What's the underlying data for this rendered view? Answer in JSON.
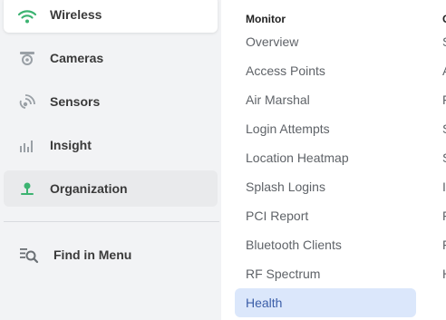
{
  "sidebar": {
    "items": [
      {
        "label": "Wireless",
        "icon": "wifi-icon"
      },
      {
        "label": "Cameras",
        "icon": "camera-icon"
      },
      {
        "label": "Sensors",
        "icon": "sensor-icon"
      },
      {
        "label": "Insight",
        "icon": "insight-chart-icon"
      },
      {
        "label": "Organization",
        "icon": "organization-icon"
      }
    ],
    "find_label": "Find in Menu"
  },
  "menu": {
    "monitor_header": "Monitor",
    "items": [
      "Overview",
      "Access Points",
      "Air Marshal",
      "Login Attempts",
      "Location Heatmap",
      "Splash Logins",
      "PCI Report",
      "Bluetooth Clients",
      "RF Spectrum",
      "Health"
    ],
    "selected": "Health",
    "second_column": {
      "header": "C",
      "items": [
        "S",
        "A",
        "F",
        "S",
        "S",
        "I",
        "F",
        "F",
        "H"
      ]
    }
  },
  "colors": {
    "accent_green": "#3cb371",
    "selected_bg": "#dbe7fb",
    "selected_text": "#3b5ea8",
    "sidebar_bg": "#f2f3f5"
  }
}
